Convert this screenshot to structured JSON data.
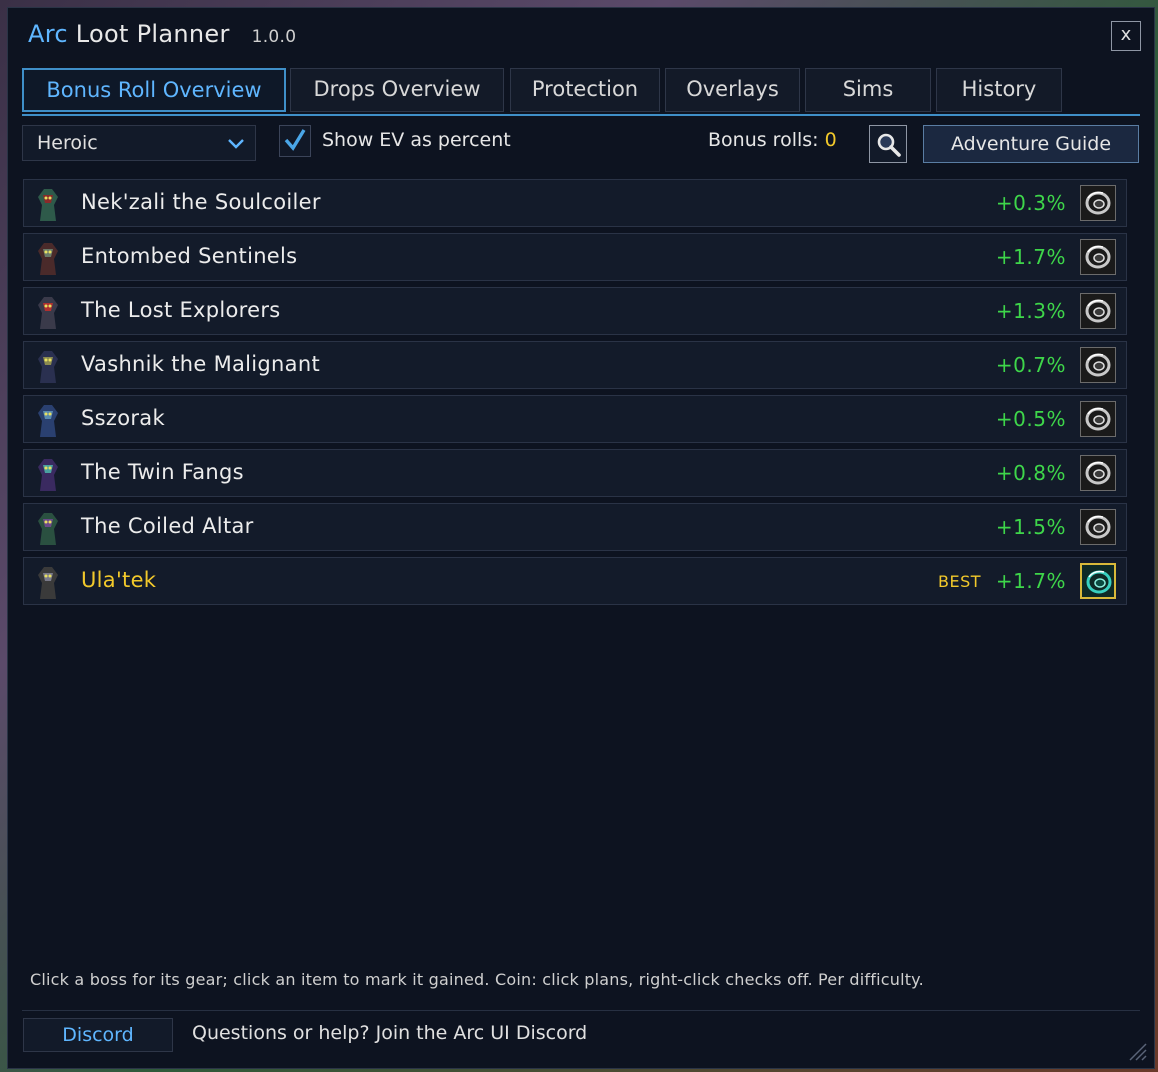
{
  "window": {
    "title_accent": "Arc",
    "title_main": "Loot Planner",
    "version": "1.0.0",
    "close_label": "x"
  },
  "tabs": [
    {
      "label": "Bonus Roll Overview",
      "active": true
    },
    {
      "label": "Drops Overview",
      "active": false
    },
    {
      "label": "Protection",
      "active": false
    },
    {
      "label": "Overlays",
      "active": false
    },
    {
      "label": "Sims",
      "active": false
    },
    {
      "label": "History",
      "active": false
    }
  ],
  "toolbar": {
    "difficulty": "Heroic",
    "show_ev_label": "Show EV as percent",
    "show_ev_checked": true,
    "bonus_rolls_label": "Bonus rolls:",
    "bonus_rolls_value": "0",
    "adventure_guide_label": "Adventure Guide"
  },
  "bosses": [
    {
      "name": "Nek'zali the Soulcoiler",
      "value": "+0.3%",
      "best": ""
    },
    {
      "name": "Entombed Sentinels",
      "value": "+1.7%",
      "best": ""
    },
    {
      "name": "The Lost Explorers",
      "value": "+1.3%",
      "best": ""
    },
    {
      "name": "Vashnik the Malignant",
      "value": "+0.7%",
      "best": ""
    },
    {
      "name": "Sszorak",
      "value": "+0.5%",
      "best": ""
    },
    {
      "name": "The Twin Fangs",
      "value": "+0.8%",
      "best": ""
    },
    {
      "name": "The Coiled Altar",
      "value": "+1.5%",
      "best": ""
    },
    {
      "name": "Ula'tek",
      "value": "+1.7%",
      "best": "BEST"
    }
  ],
  "hint": "Click a boss for its gear; click an item to mark it gained. Coin: click plans, right-click checks off. Per difficulty.",
  "footer": {
    "discord_label": "Discord",
    "help_text": "Questions or help? Join the Arc UI Discord"
  },
  "colors": {
    "accent": "#5fb6ff",
    "value_green": "#3ed64a",
    "best_gold": "#f2c92b",
    "background": "#0d1320"
  }
}
